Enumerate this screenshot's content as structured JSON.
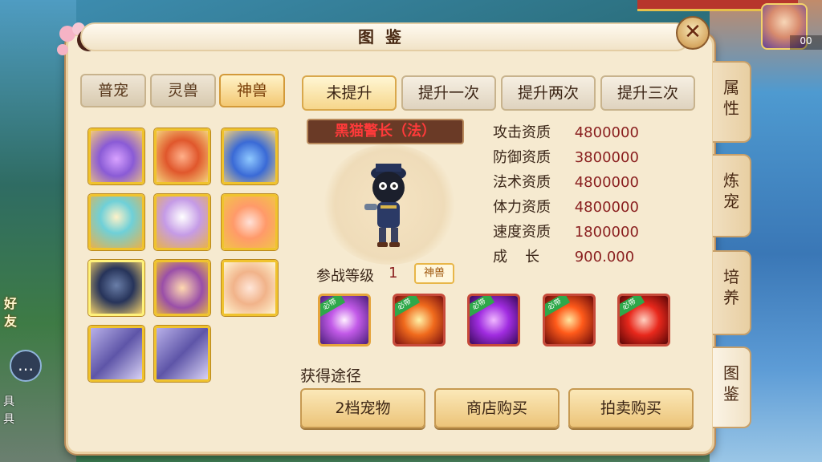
{
  "window": {
    "title": "图鉴",
    "close_label": "✕"
  },
  "background": {
    "friend_label": "好\n友",
    "hero_level": "00",
    "side_chars": [
      "具",
      "具"
    ]
  },
  "type_tabs": [
    {
      "label": "普宠",
      "active": false
    },
    {
      "label": "灵兽",
      "active": false
    },
    {
      "label": "神兽",
      "active": true
    }
  ],
  "level_tabs": [
    {
      "label": "未提升",
      "active": true
    },
    {
      "label": "提升一次",
      "active": false
    },
    {
      "label": "提升两次",
      "active": false
    },
    {
      "label": "提升三次",
      "active": false
    }
  ],
  "pet": {
    "name": "黑猫警长（法）",
    "battle_level_label": "参战等级",
    "battle_level": "1",
    "badge": "神兽"
  },
  "stats": [
    {
      "label": "攻击资质",
      "value": "4800000"
    },
    {
      "label": "防御资质",
      "value": "3800000"
    },
    {
      "label": "法术资质",
      "value": "4800000"
    },
    {
      "label": "体力资质",
      "value": "4800000"
    },
    {
      "label": "速度资质",
      "value": "1800000"
    },
    {
      "label": "成长",
      "value": "900.000"
    }
  ],
  "skills": [
    {
      "icon": "purple-swirl-icon",
      "tag": "必带"
    },
    {
      "icon": "lightning-icon",
      "tag": "必带"
    },
    {
      "icon": "purple-beast-icon",
      "tag": "必带"
    },
    {
      "icon": "fire-swirl-icon",
      "tag": "必带"
    },
    {
      "icon": "red-flame-icon",
      "tag": "必带"
    }
  ],
  "source": {
    "title": "获得途径",
    "buttons": [
      "2档宠物",
      "商店购买",
      "拍卖购买"
    ]
  },
  "side_tabs": [
    {
      "label": "属\n性",
      "active": false
    },
    {
      "label": "炼\n宠",
      "active": false
    },
    {
      "label": "培\n养",
      "active": false
    },
    {
      "label": "图\n鉴",
      "active": true
    }
  ],
  "colors": {
    "accent_gold": "#f0c32e",
    "stat_value": "#8a1f1f",
    "name_red": "#ff3a3a"
  }
}
